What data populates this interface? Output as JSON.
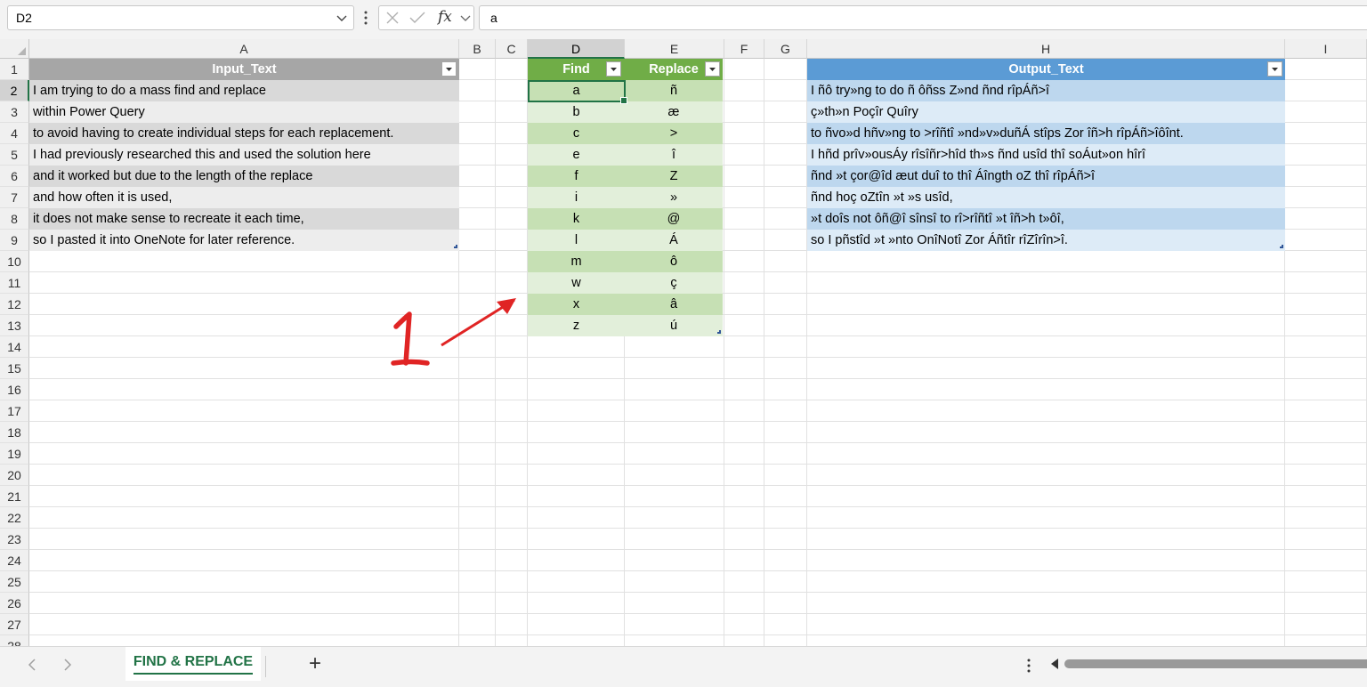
{
  "formula_bar": {
    "name_box": "D2",
    "formula": "a",
    "fx_label": "fx"
  },
  "columns": [
    "A",
    "B",
    "C",
    "D",
    "E",
    "F",
    "G",
    "H",
    "I"
  ],
  "rows": [
    "1",
    "2",
    "3",
    "4",
    "5",
    "6",
    "7",
    "8",
    "9",
    "10",
    "11",
    "12",
    "13",
    "14",
    "15",
    "16",
    "17",
    "18",
    "19",
    "20",
    "21",
    "22",
    "23",
    "24",
    "25",
    "26",
    "27",
    "28"
  ],
  "input_table": {
    "header": "Input_Text",
    "rows": [
      "I am trying to do a mass find and replace",
      "within Power Query",
      "to avoid having to create individual steps for each replacement.",
      "I had previously researched this and used the solution here",
      "and it worked but due to the length of the replace",
      "and how often it is used,",
      "it does not make sense to recreate it each time,",
      "so I pasted it into OneNote for later reference."
    ]
  },
  "replace_table": {
    "find_header": "Find",
    "replace_header": "Replace",
    "rows": [
      {
        "find": "a",
        "replace": "ñ"
      },
      {
        "find": "b",
        "replace": "æ"
      },
      {
        "find": "c",
        "replace": ">"
      },
      {
        "find": "e",
        "replace": "î"
      },
      {
        "find": "f",
        "replace": "Z"
      },
      {
        "find": "i",
        "replace": "»"
      },
      {
        "find": "k",
        "replace": "@"
      },
      {
        "find": "l",
        "replace": "Á"
      },
      {
        "find": "m",
        "replace": "ô"
      },
      {
        "find": "w",
        "replace": "ç"
      },
      {
        "find": "x",
        "replace": "â"
      },
      {
        "find": "z",
        "replace": "ú"
      }
    ]
  },
  "output_table": {
    "header": "Output_Text",
    "rows": [
      "I ñô try»ng to do ñ ôñss Z»nd ñnd rîpÁñ>î",
      "ç»th»n Poçîr Quîry",
      "to ñvo»d hñv»ng to >rîñtî »nd»v»duñÁ stîps Zor îñ>h rîpÁñ>îôînt.",
      "I hñd prîv»ousÁy rîsîñr>hîd th»s ñnd usîd thî soÁut»on hîrî",
      "ñnd »t çor@îd æut duî to thî Áîngth oZ thî rîpÁñ>î",
      "ñnd hoç oZtîn »t »s usîd,",
      "»t doîs not ôñ@î sînsî to rî>rîñtî »t îñ>h t»ôî,",
      "so I pñstîd »t »nto OnîNotî Zor Áñtîr rîZîrîn>î."
    ]
  },
  "annotation": {
    "text": "1",
    "color": "#e02424"
  },
  "sheet_tabs": {
    "active_tab": "FIND & REPLACE",
    "add_label": "+"
  },
  "colors": {
    "input_header": "#a6a6a6",
    "input_band_dark": "#d9d9d9",
    "input_band_light": "#ededed",
    "find_header": "#70ad47",
    "find_band_dark": "#c6e0b4",
    "find_band_light": "#e2efda",
    "output_header": "#5b9bd5",
    "output_band_dark": "#bdd7ee",
    "output_band_light": "#ddebf7",
    "accent": "#217346"
  }
}
